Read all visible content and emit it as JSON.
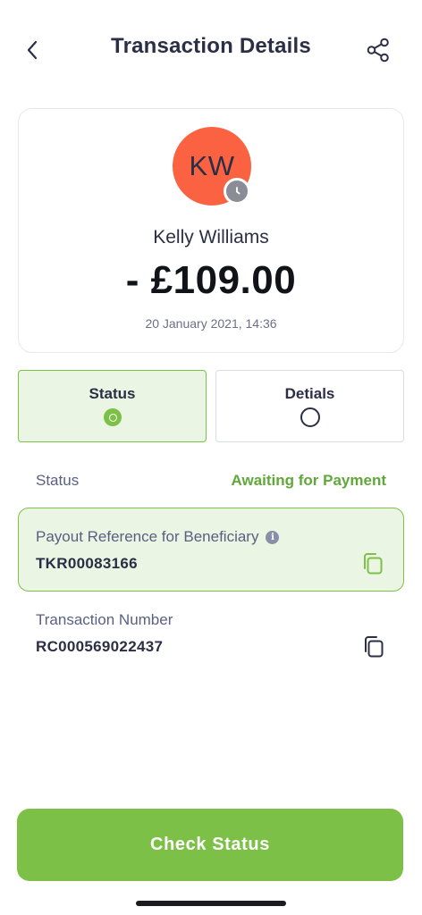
{
  "header": {
    "title": "Transaction Details",
    "back_icon": "chevron-left-icon",
    "share_icon": "share-icon"
  },
  "summary": {
    "avatar_initials": "KW",
    "avatar_color": "#fa6242",
    "badge_icon": "clock-icon",
    "payee_name": "Kelly Williams",
    "amount": "- £109.00",
    "datetime": "20 January 2021, 14:36"
  },
  "tabs": [
    {
      "label": "Status",
      "selected": true
    },
    {
      "label": "Detials",
      "selected": false
    }
  ],
  "status_row": {
    "label": "Status",
    "value": "Awaiting for Payment"
  },
  "payout_reference": {
    "label": "Payout Reference for Beneficiary",
    "info_icon": "info-icon",
    "value": "TKR00083166",
    "copy_icon": "copy-icon"
  },
  "transaction_number": {
    "label": "Transaction Number",
    "value": "RC000569022437",
    "copy_icon": "copy-icon"
  },
  "cta": {
    "label": "Check Status"
  },
  "colors": {
    "accent": "#7dc048",
    "accent_light": "#eaf5e4",
    "text_primary": "#2b2f45",
    "text_secondary": "#5a6082",
    "status_text": "#5fa83a"
  }
}
